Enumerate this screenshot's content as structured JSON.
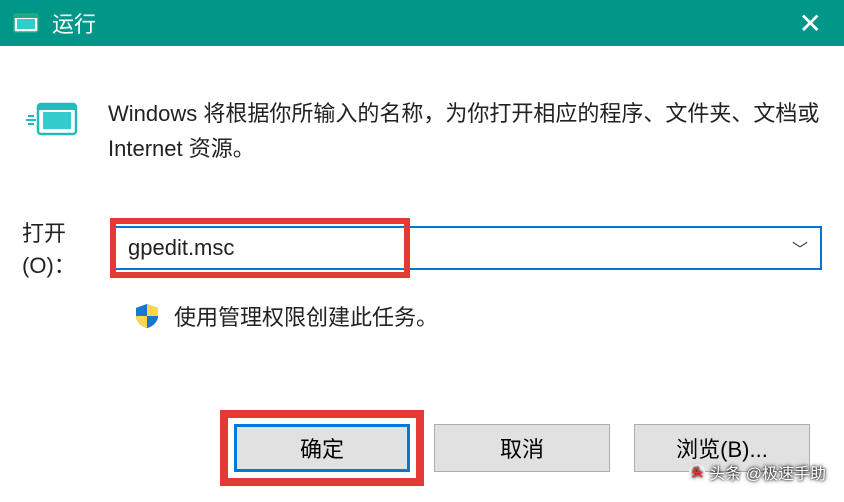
{
  "titlebar": {
    "title": "运行"
  },
  "content": {
    "description": "Windows 将根据你所输入的名称，为你打开相应的程序、文件夹、文档或 Internet 资源。",
    "open_label": "打开(O)：",
    "input_value": "gpedit.msc",
    "admin_note": "使用管理权限创建此任务。"
  },
  "buttons": {
    "ok": "确定",
    "cancel": "取消",
    "browse": "浏览(B)..."
  },
  "watermark": "头条 @极速手助"
}
